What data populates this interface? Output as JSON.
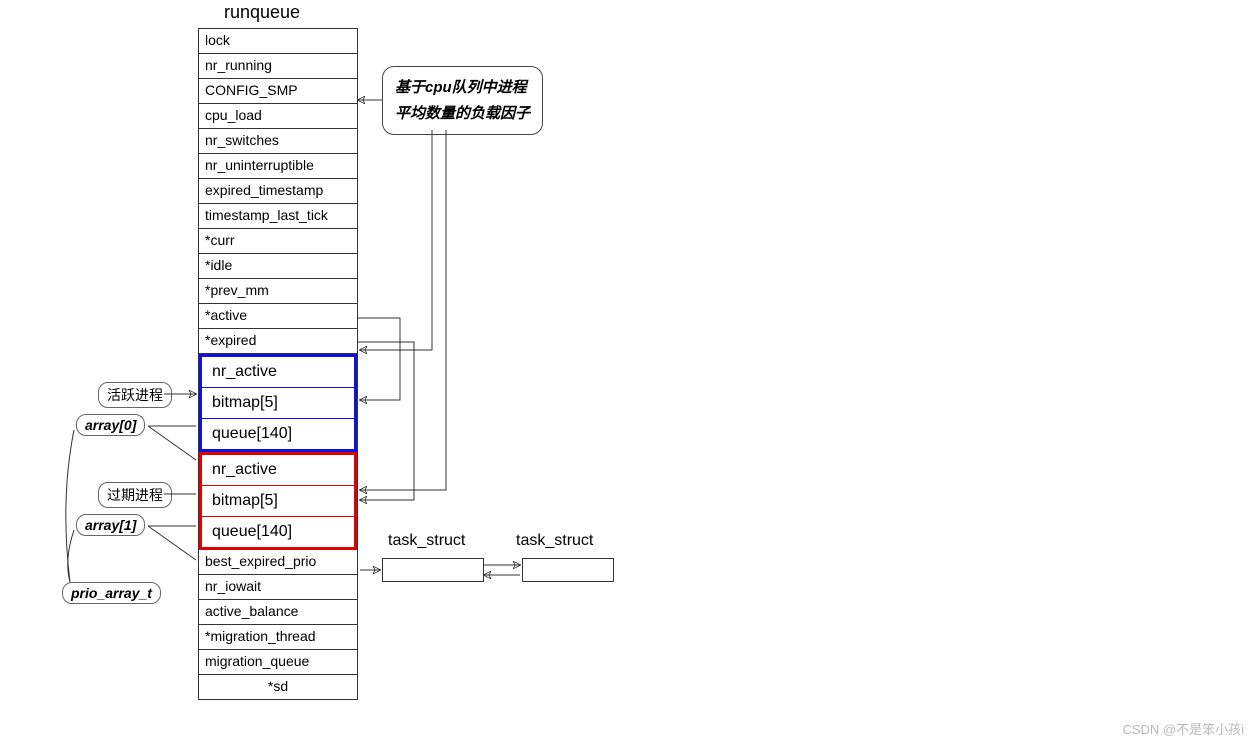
{
  "title": "runqueue",
  "fields_top": [
    "lock",
    "nr_running",
    "CONFIG_SMP",
    "cpu_load",
    "nr_switches",
    "nr_uninterruptible",
    "expired_timestamp",
    "timestamp_last_tick",
    "*curr",
    "*idle",
    "*prev_mm",
    "*active",
    "*expired"
  ],
  "prio_blue": {
    "nr": "nr_active",
    "bitmap": "bitmap[5]",
    "queue": "queue[140]"
  },
  "prio_red": {
    "nr": "nr_active",
    "bitmap": "bitmap[5]",
    "queue": "queue[140]"
  },
  "fields_bottom": [
    "best_expired_prio",
    "nr_iowait",
    "active_balance",
    "*migration_thread",
    "migration_queue",
    "*sd"
  ],
  "callout": {
    "line1": "基于cpu队列中进程",
    "line2": "平均数量的负载因子"
  },
  "labels": {
    "active_proc": "活跃进程",
    "expired_proc": "过期进程",
    "array0": "array[0]",
    "array1": "array[1]",
    "prio_array_t": "prio_array_t"
  },
  "task_struct": "task_struct",
  "watermark": "CSDN @不是笨小孩i"
}
